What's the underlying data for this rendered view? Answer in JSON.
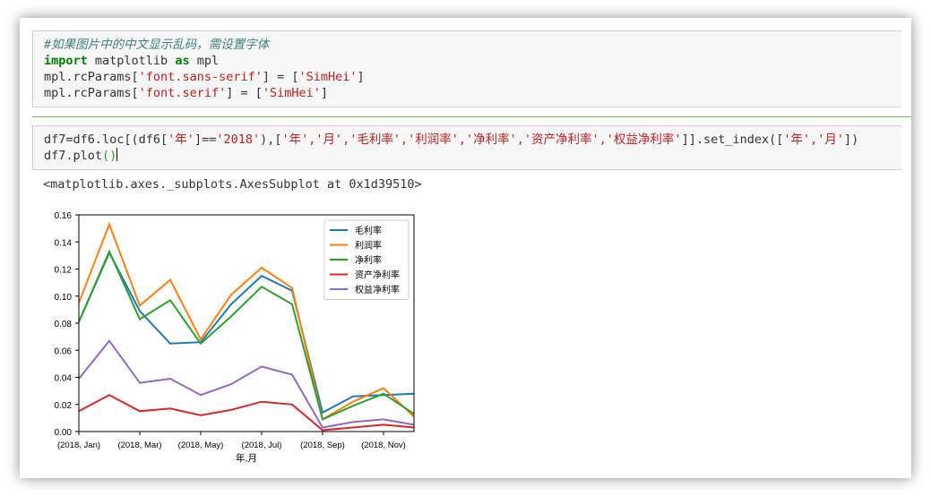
{
  "cell1": {
    "comment": "#如果图片中的中文显示乱码，需设置字体",
    "import_kw": "import",
    "import_mod": " matplotlib ",
    "as_kw": "as",
    "import_alias": " mpl",
    "line3_pre": "mpl.rcParams[",
    "line3_key": "'font.sans-serif'",
    "line3_mid": "] = [",
    "line3_val": "'SimHei'",
    "line3_end": "]",
    "line4_pre": "mpl.rcParams[",
    "line4_key": "'font.serif'",
    "line4_mid": "] = [",
    "line4_val": "'SimHei'",
    "line4_end": "]"
  },
  "cell2": {
    "l1_a": "df7=df6.loc[(df6[",
    "l1_b": "'年'",
    "l1_c": "]==",
    "l1_d": "'2018'",
    "l1_e": "),[",
    "l1_f": "'年','月','毛利率','利润率','净利率','资产净利率','权益净利率'",
    "l1_g": "]].set_index([",
    "l1_h": "'年','月'",
    "l1_i": "])",
    "l2_a": "df7.plot",
    "l2_b": "()"
  },
  "output_text": "<matplotlib.axes._subplots.AxesSubplot at 0x1d39510>",
  "chart_data": {
    "type": "line",
    "xlabel": "年,月",
    "ylabel": "",
    "ylim": [
      0,
      0.16
    ],
    "y_ticks": [
      "0.00",
      "0.02",
      "0.04",
      "0.06",
      "0.08",
      "0.10",
      "0.12",
      "0.14",
      "0.16"
    ],
    "x_tick_labels": [
      "(2018, Jan)",
      "(2018, Mar)",
      "(2018, May)",
      "(2018, Jul)",
      "(2018, Sep)",
      "(2018, Nov)"
    ],
    "categories": [
      "(2018, Jan)",
      "(2018, Feb)",
      "(2018, Mar)",
      "(2018, Apr)",
      "(2018, May)",
      "(2018, Jun)",
      "(2018, Jul)",
      "(2018, Aug)",
      "(2018, Sep)",
      "(2018, Oct)",
      "(2018, Nov)",
      "(2018, Dec)"
    ],
    "legend_position": "top-right",
    "grid": false,
    "series": [
      {
        "name": "毛利率",
        "color": "#1f77b4",
        "values": [
          0.081,
          0.132,
          0.089,
          0.065,
          0.066,
          0.094,
          0.115,
          0.104,
          0.014,
          0.026,
          0.027,
          0.028
        ]
      },
      {
        "name": "利润率",
        "color": "#ff7f0e",
        "values": [
          0.095,
          0.153,
          0.093,
          0.112,
          0.068,
          0.101,
          0.121,
          0.106,
          0.009,
          0.022,
          0.032,
          0.011
        ]
      },
      {
        "name": "净利率",
        "color": "#2ca02c",
        "values": [
          0.081,
          0.133,
          0.083,
          0.097,
          0.065,
          0.085,
          0.107,
          0.094,
          0.009,
          0.019,
          0.028,
          0.013
        ]
      },
      {
        "name": "资产净利率",
        "color": "#d62728",
        "values": [
          0.015,
          0.027,
          0.015,
          0.017,
          0.012,
          0.016,
          0.022,
          0.02,
          0.001,
          0.003,
          0.005,
          0.003
        ]
      },
      {
        "name": "权益净利率",
        "color": "#9467bd",
        "values": [
          0.039,
          0.067,
          0.036,
          0.039,
          0.027,
          0.035,
          0.048,
          0.042,
          0.003,
          0.007,
          0.009,
          0.005
        ]
      }
    ]
  }
}
